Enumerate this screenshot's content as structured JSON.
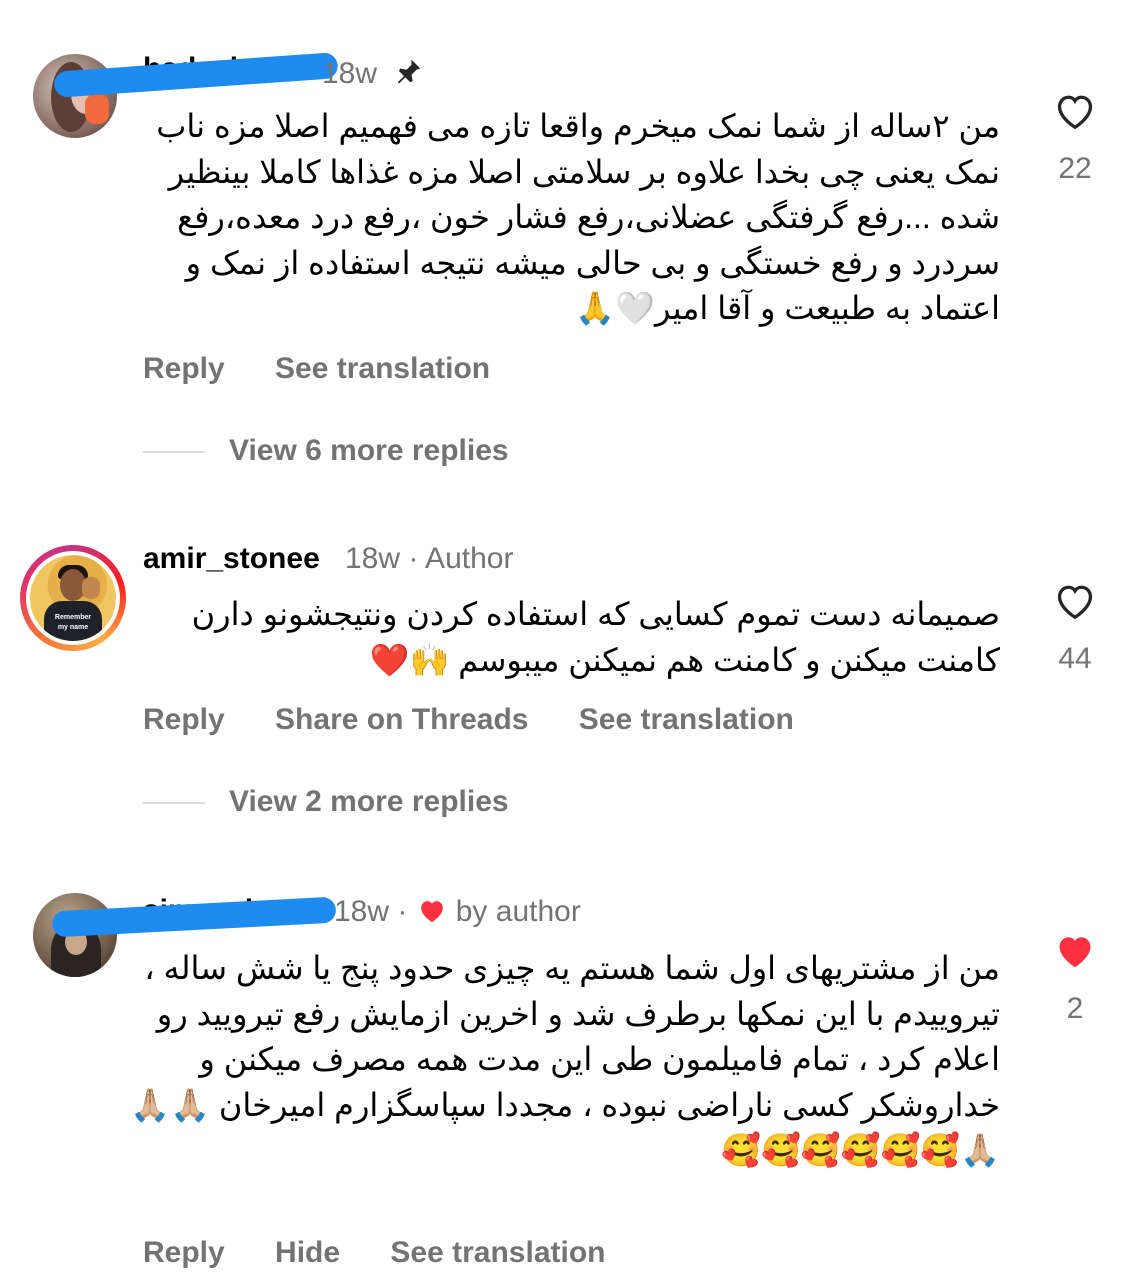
{
  "comments": [
    {
      "username": "hadyeh_n",
      "time": "18w",
      "text": "من ۲ساله از شما نمک میخرم واقعا تازه می فهمیم اصلا مزه ناب نمک یعنی چی بخدا علاوه بر سلامتی اصلا مزه غذاها کاملا بینظیر شده ...رفع گرفتگی عضلانی،رفع فشار خون ،رفع درد معده،رفع سردرد و رفع خستگی و بی حالی میشه نتیجه استفاده از نمک و اعتماد به طبیعت و آقا امیر🤍🙏",
      "actions": [
        "Reply",
        "See translation"
      ],
      "view_more": "View 6 more replies",
      "like_count": "22",
      "liked": false
    },
    {
      "username": "amir_stonee",
      "time": "18w",
      "badge": "· Author",
      "avatar_text": "Remember my name",
      "text": "صمیمانه دست تموم کسایی که استفاده کردن ونتیجشونو دارن کامنت میکنن و کامنت هم نمیکنن میبوسم 🙌❤️",
      "actions": [
        "Reply",
        "Share on Threads",
        "See translation"
      ],
      "view_more": "View 2 more replies",
      "like_count": "44",
      "liked": false
    },
    {
      "username": "simaashrafi",
      "time": "18w",
      "badge": "by author",
      "text": "من از مشتریهای اول شما هستم یه چیزی حدود پنج  یا شش ساله ، تیروییدم با این نمکها برطرف شد و اخرین ازمایش رفع تیرویید رو اعلام کرد ، تمام فامیلمون طی این مدت همه مصرف میکنن و خداروشکر کسی ناراضی نبوده ، مجددا سپاسگزارم امیرخان 🙏🏼🙏🏼🙏🏼🥰🥰🥰🥰🥰🥰",
      "actions": [
        "Reply",
        "Hide",
        "See translation"
      ],
      "like_count": "2",
      "liked": true
    }
  ],
  "colors": {
    "secondary_text": "#737373",
    "liked_heart": "#ff3040",
    "redaction": "#1d8bf0"
  },
  "icons": [
    "pin-icon",
    "heart-outline-icon",
    "heart-filled-icon"
  ]
}
